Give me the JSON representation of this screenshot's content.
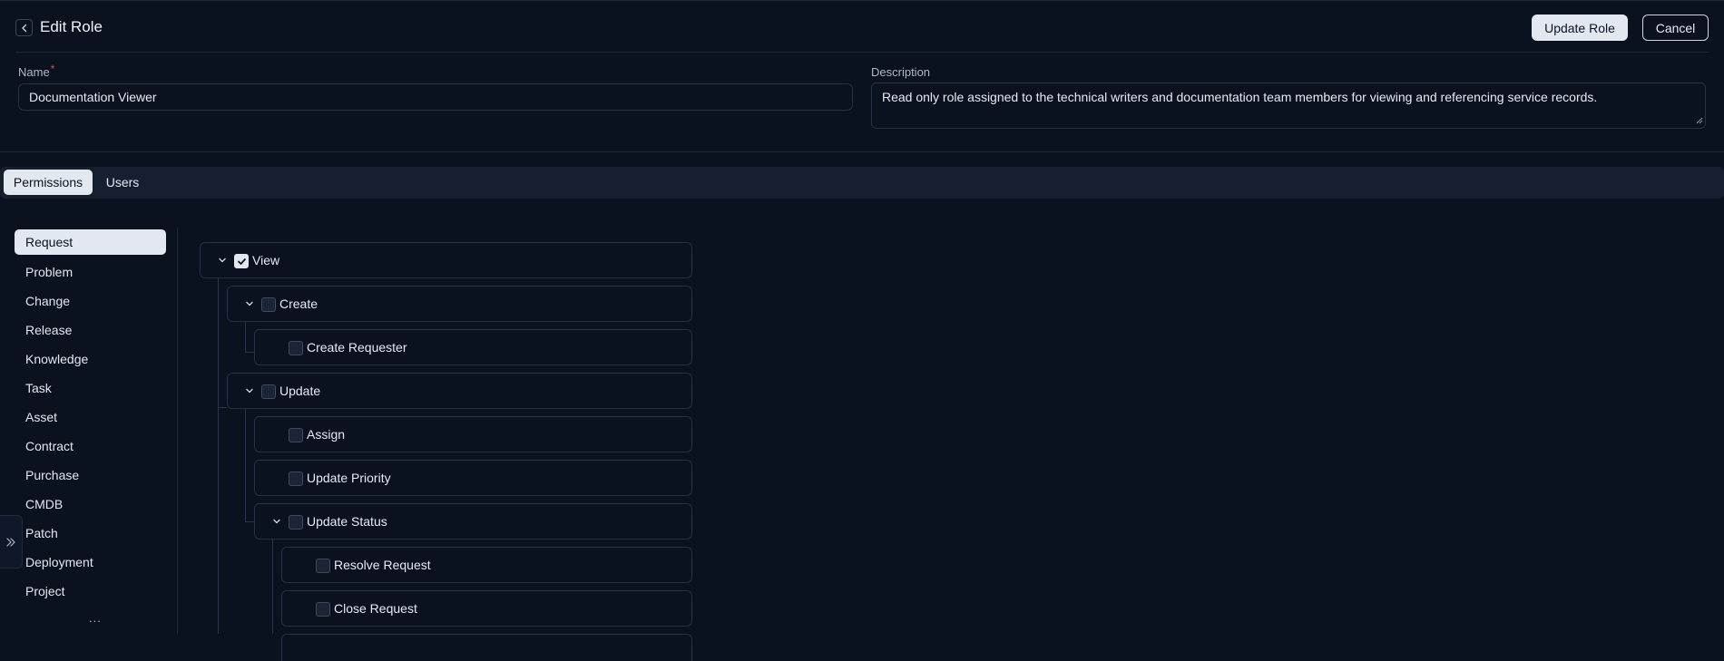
{
  "header": {
    "title": "Edit Role",
    "update_button": "Update Role",
    "cancel_button": "Cancel"
  },
  "form": {
    "name_label": "Name",
    "required_mark": "*",
    "name_value": "Documentation Viewer",
    "description_label": "Description",
    "description_value": "Read only role assigned to the technical writers and documentation team members for viewing and referencing service records."
  },
  "tabs": [
    {
      "label": "Permissions",
      "active": true
    },
    {
      "label": "Users",
      "active": false
    }
  ],
  "sidebar": {
    "items": [
      {
        "label": "Request",
        "active": true
      },
      {
        "label": "Problem"
      },
      {
        "label": "Change"
      },
      {
        "label": "Release"
      },
      {
        "label": "Knowledge"
      },
      {
        "label": "Task"
      },
      {
        "label": "Asset"
      },
      {
        "label": "Contract"
      },
      {
        "label": "Purchase"
      },
      {
        "label": "CMDB"
      },
      {
        "label": "Patch"
      },
      {
        "label": "Deployment"
      },
      {
        "label": "Project"
      }
    ],
    "more": "..."
  },
  "permissions": [
    {
      "label": "View",
      "checked": true,
      "expanded": true
    },
    {
      "label": "Create",
      "checked": false,
      "expanded": true
    },
    {
      "label": "Create Requester",
      "checked": false
    },
    {
      "label": "Update",
      "checked": false,
      "expanded": true
    },
    {
      "label": "Assign",
      "checked": false
    },
    {
      "label": "Update Priority",
      "checked": false
    },
    {
      "label": "Update Status",
      "checked": false,
      "expanded": true
    },
    {
      "label": "Resolve Request",
      "checked": false
    },
    {
      "label": "Close Request",
      "checked": false
    }
  ]
}
